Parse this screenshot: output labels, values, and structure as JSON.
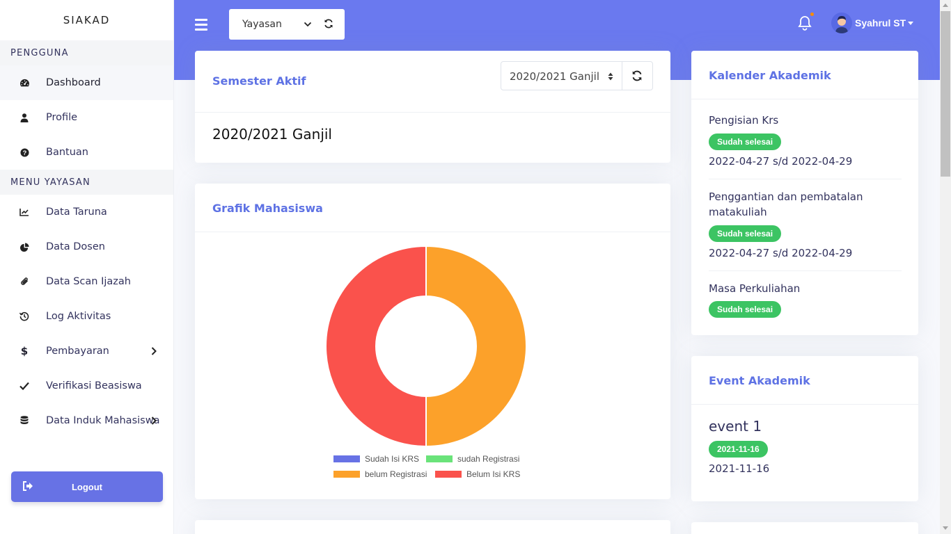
{
  "app": {
    "brand": "SIAKAD"
  },
  "sidebar": {
    "sections": [
      {
        "heading": "PENGGUNA"
      },
      {
        "heading": "MENU YAYASAN"
      }
    ],
    "items": [
      {
        "label": "Dashboard",
        "icon": "dashboard-icon",
        "active": true
      },
      {
        "label": "Profile",
        "icon": "user-icon"
      },
      {
        "label": "Bantuan",
        "icon": "question-icon"
      },
      {
        "label": "Data Taruna",
        "icon": "chart-line-icon"
      },
      {
        "label": "Data Dosen",
        "icon": "pie-chart-icon"
      },
      {
        "label": "Data Scan Ijazah",
        "icon": "paperclip-icon"
      },
      {
        "label": "Log Aktivitas",
        "icon": "history-icon"
      },
      {
        "label": "Pembayaran",
        "icon": "dollar-icon",
        "has_submenu": true
      },
      {
        "label": "Verifikasi Beasiswa",
        "icon": "check-icon"
      },
      {
        "label": "Data Induk Mahasiswa",
        "icon": "database-icon",
        "has_submenu": true
      }
    ],
    "logout_label": "Logout"
  },
  "header": {
    "role_select": "Yayasan",
    "username": "Syahrul ST",
    "accent": "#6a79ef"
  },
  "semester_card": {
    "title": "Semester Aktif",
    "select_value": "2020/2021 Ganjil",
    "active_semester": "2020/2021 Ganjil"
  },
  "chart_card": {
    "title": "Grafik Mahasiswa"
  },
  "chart_data": {
    "type": "pie",
    "donut": true,
    "title": "",
    "legend_position": "bottom",
    "series": [
      {
        "name": "Sudah Isi KRS",
        "value": 0,
        "color": "#6772e5"
      },
      {
        "name": "sudah Registrasi",
        "value": 0,
        "color": "#6ae37a"
      },
      {
        "name": "belum Registrasi",
        "value": 50,
        "color": "#fca12a"
      },
      {
        "name": "Belum Isi KRS",
        "value": 50,
        "color": "#fa524c"
      }
    ]
  },
  "kalender": {
    "title": "Kalender Akademik",
    "items": [
      {
        "title": "Pengisian Krs",
        "status": "Sudah selesai",
        "range": "2022-04-27 s/d 2022-04-29"
      },
      {
        "title_line1": "Penggantian dan pembatalan",
        "title_line2": "matakuliah",
        "status": "Sudah selesai",
        "range": "2022-04-27 s/d 2022-04-29"
      },
      {
        "title": "Masa Perkuliahan",
        "status": "Sudah selesai"
      }
    ]
  },
  "events": {
    "title": "Event Akademik",
    "items": [
      {
        "name": "event 1",
        "badge": "2021-11-16",
        "date": "2021-11-16"
      }
    ]
  }
}
